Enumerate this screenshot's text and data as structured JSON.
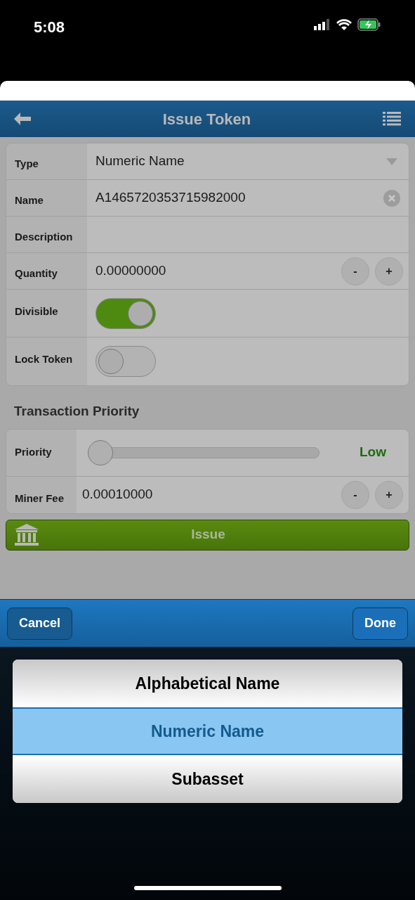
{
  "status_bar": {
    "time": "5:08"
  },
  "header": {
    "title": "Issue Token"
  },
  "fields": [
    {
      "kind": "select",
      "label": "Type",
      "value": "Numeric Name"
    },
    {
      "kind": "clearable",
      "label": "Name",
      "value": "A1465720353715982000"
    },
    {
      "kind": "text",
      "label": "Description"
    },
    {
      "kind": "stepper",
      "label": "Quantity",
      "value": "0.00000000",
      "minus": "-",
      "plus": "+"
    },
    {
      "kind": "toggle",
      "label": "Divisible",
      "on": true
    },
    {
      "kind": "toggle",
      "label": "Lock Token",
      "on": false
    }
  ],
  "priority_section": {
    "title": "Transaction Priority",
    "priority": {
      "label": "Priority",
      "level": 0,
      "reading": "Low"
    },
    "miner_fee": {
      "label": "Miner Fee",
      "value": "0.00010000",
      "minus": "-",
      "plus": "+"
    }
  },
  "issue_button": {
    "label": "Issue"
  },
  "picker_toolbar": {
    "cancel": "Cancel",
    "done": "Done"
  },
  "picker_options": [
    {
      "label": "Alphabetical Name",
      "selected": false
    },
    {
      "label": "Numeric Name",
      "selected": true
    },
    {
      "label": "Subasset",
      "selected": false
    }
  ]
}
